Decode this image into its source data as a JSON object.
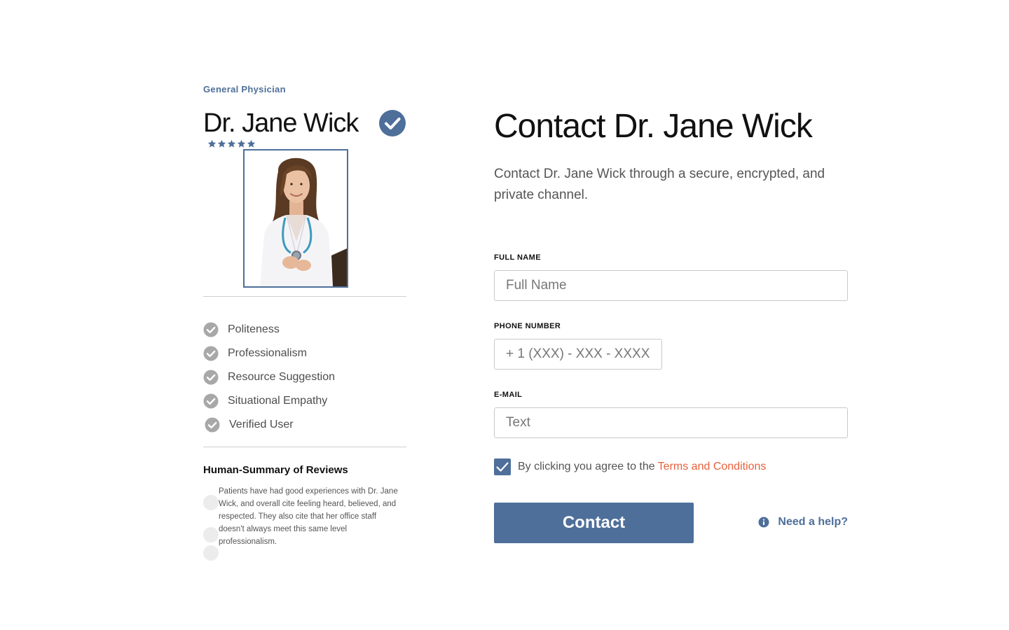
{
  "profile": {
    "specialty": "General Physician",
    "name": "Dr. Jane Wick",
    "rating": 5,
    "rating_max": 5,
    "traits": [
      {
        "label": "Politeness"
      },
      {
        "label": "Professionalism"
      },
      {
        "label": "Resource Suggestion"
      },
      {
        "label": "Situational Empathy"
      },
      {
        "label": "Verified User"
      }
    ],
    "summary": {
      "title": "Human-Summary of Reviews",
      "text": "Patients have had good experiences with Dr. Jane Wick, and overall cite feeling heard, believed, and respected. They also cite that her office staff doesn't always meet this same level professionalism."
    }
  },
  "form": {
    "title": "Contact Dr. Jane Wick",
    "description": "Contact Dr. Jane Wick through a secure, encrypted, and private channel.",
    "full_name": {
      "label": "FULL NAME",
      "placeholder": "Full Name",
      "value": ""
    },
    "phone": {
      "label": "PHONE NUMBER",
      "placeholder": "+ 1 (XXX) - XXX - XXXX",
      "value": ""
    },
    "email": {
      "label": "E-MAIL",
      "placeholder": "Text",
      "value": ""
    },
    "agree": {
      "checked": true,
      "text": "By clicking you agree to the",
      "link_text": "Terms and Conditions"
    },
    "submit_label": "Contact",
    "help_label": "Need a help?"
  },
  "colors": {
    "accent": "#4e6f9a",
    "link": "#e8613c",
    "check_gray": "#a8a8a8",
    "text_muted": "#555555"
  },
  "icons": {
    "verified": "verified-check-icon",
    "star": "star-icon",
    "trait_check": "check-circle-icon",
    "checkbox": "checkmark-icon",
    "help": "info-icon"
  }
}
